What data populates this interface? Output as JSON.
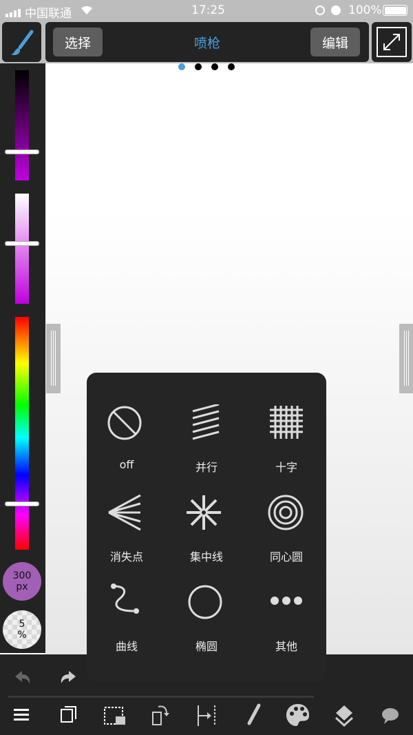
{
  "status": {
    "carrier": "中国联通",
    "time": "17:25",
    "battery": "100%"
  },
  "header": {
    "select_label": "选择",
    "title": "喷枪",
    "edit_label": "编辑",
    "page_dots": 4,
    "active_dot": 0
  },
  "accent_color": "#4d9ddb",
  "left_panel": {
    "brush_size": "300",
    "brush_size_unit": "px",
    "opacity": "5",
    "opacity_unit": "%"
  },
  "popup": {
    "items": [
      {
        "label": "off",
        "icon": "prohibited-icon"
      },
      {
        "label": "并行",
        "icon": "parallel-lines-icon"
      },
      {
        "label": "十字",
        "icon": "grid-icon"
      },
      {
        "label": "消失点",
        "icon": "vanishing-point-icon"
      },
      {
        "label": "集中线",
        "icon": "focus-lines-icon"
      },
      {
        "label": "同心圆",
        "icon": "concentric-circles-icon"
      },
      {
        "label": "曲线",
        "icon": "curve-icon"
      },
      {
        "label": "椭圆",
        "icon": "ellipse-icon"
      },
      {
        "label": "其他",
        "icon": "more-icon"
      }
    ]
  },
  "bottom_toolbar": [
    "menu-icon",
    "layers-copy-icon",
    "selection-icon",
    "rotate-icon",
    "ruler-icon",
    "brush-icon",
    "palette-icon",
    "layers-icon",
    "speech-bubble-icon"
  ]
}
